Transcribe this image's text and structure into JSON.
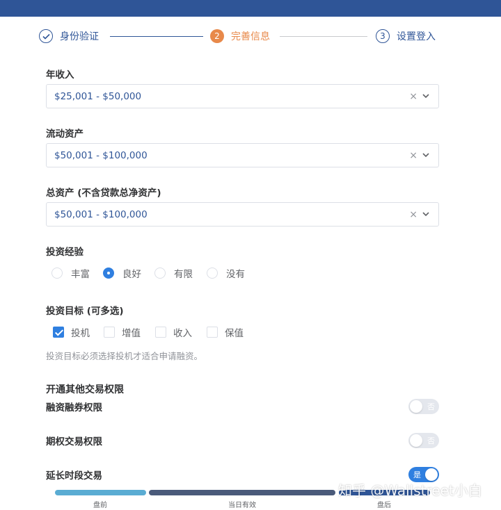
{
  "steps": [
    {
      "icon": "check-circle-icon",
      "label": "身份验证"
    },
    {
      "number": "2",
      "label": "完善信息"
    },
    {
      "number": "3",
      "label": "设置登入"
    }
  ],
  "fields": {
    "annual_income": {
      "label": "年收入",
      "value": "$25,001 - $50,000"
    },
    "liquid_assets": {
      "label": "流动资产",
      "value": "$50,001 - $100,000"
    },
    "total_assets": {
      "label": "总资产 (不含贷款总净资产)",
      "value": "$50,001 - $100,000"
    }
  },
  "clear_glyph": "×",
  "experience": {
    "label": "投资经验",
    "options": [
      "丰富",
      "良好",
      "有限",
      "没有"
    ],
    "selected": "良好"
  },
  "objectives": {
    "label": "投资目标 (可多选)",
    "options": [
      "投机",
      "增值",
      "收入",
      "保值"
    ],
    "checked": [
      "投机"
    ],
    "hint": "投资目标必须选择投机才适合申请融资。"
  },
  "permissions": {
    "title": "开通其他交易权限",
    "items": [
      {
        "label": "融资融券权限",
        "state_text": "否",
        "on": false
      },
      {
        "label": "期权交易权限",
        "state_text": "否",
        "on": false
      },
      {
        "label": "延长时段交易",
        "state_text": "是",
        "on": true
      }
    ]
  },
  "sessions": {
    "labels": [
      "盘前",
      "当日有效",
      "盘后"
    ]
  },
  "watermark": "知乎 @Wallstreet小白",
  "colors": {
    "brand": "#2f5597",
    "accent": "#2f7fe0",
    "step_active": "#e8894a"
  }
}
